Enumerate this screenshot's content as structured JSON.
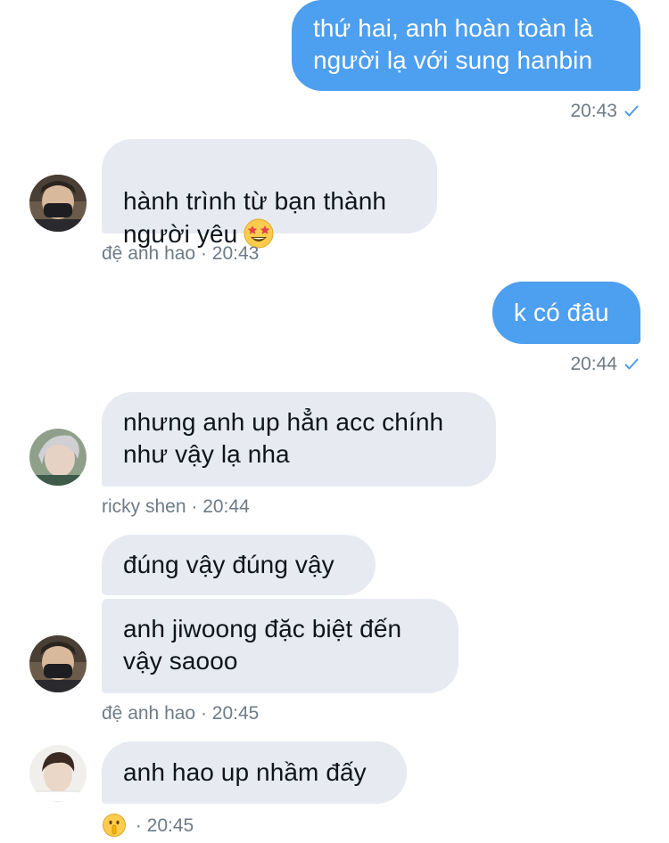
{
  "messages": [
    {
      "id": "m1",
      "direction": "outgoing",
      "text": "thứ hai, anh hoàn toàn là\nngười lạ với sung hanbin",
      "time": "20:43"
    },
    {
      "id": "m2",
      "direction": "incoming",
      "text": "hành trình từ bạn thành\nngười yêu",
      "emoji": "star-struck-emoji",
      "sender": "đệ anh hao",
      "time": "20:43"
    },
    {
      "id": "m3",
      "direction": "outgoing",
      "text": "k có đâu",
      "time": "20:44"
    },
    {
      "id": "m4",
      "direction": "incoming",
      "text": "nhưng anh up hẳn acc chính\nnhư vậy lạ nha",
      "sender": "ricky shen",
      "time": "20:44"
    },
    {
      "id": "m5",
      "direction": "incoming",
      "text": "đúng vậy đúng vậy"
    },
    {
      "id": "m6",
      "direction": "incoming",
      "text": "anh jiwoong đặc biệt đến\nvậy saooo",
      "sender": "đệ anh hao",
      "time": "20:45"
    },
    {
      "id": "m7",
      "direction": "incoming",
      "text": "anh hao up nhầm đấy",
      "reaction": "shushing-face-emoji",
      "time": "20:45"
    }
  ],
  "meta_separator": " · ",
  "colors": {
    "outgoing_bubble": "#4d9ff0",
    "incoming_bubble": "#e7ebf1",
    "meta_text": "#6e7b87",
    "read_check": "#4d9ff0"
  },
  "icons": {
    "sent_check": "check-icon"
  }
}
